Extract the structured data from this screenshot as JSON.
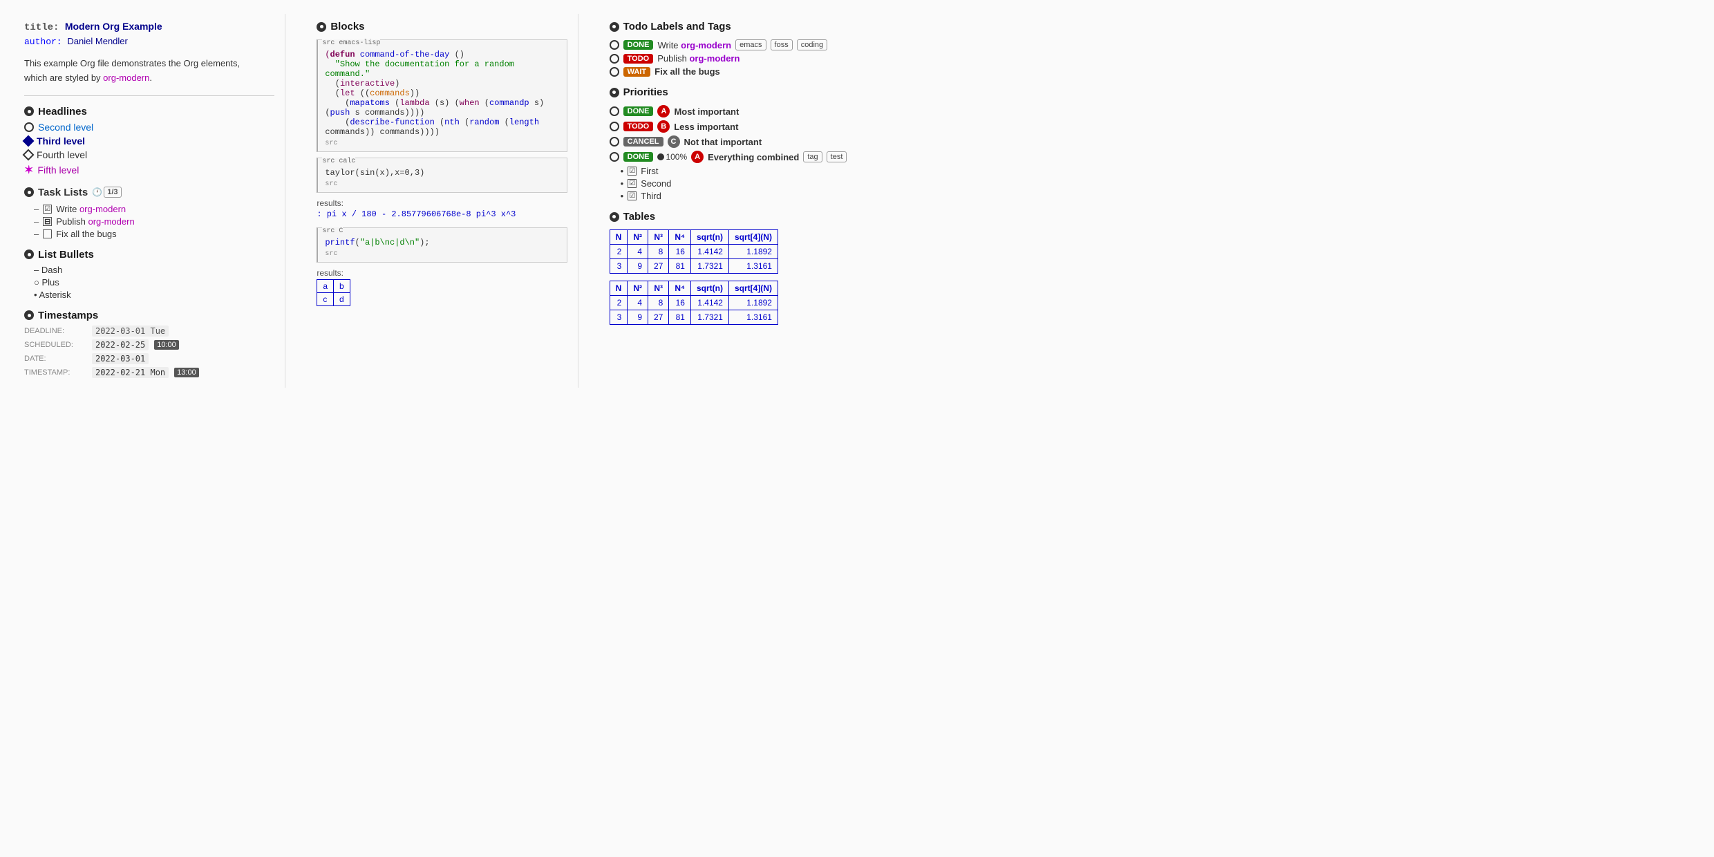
{
  "col1": {
    "meta": {
      "title_label": "title:",
      "title_value": "Modern Org Example",
      "author_label": "author:",
      "author_value": "Daniel Mendler"
    },
    "intro": "This example Org file demonstrates the Org elements, which are styled by org-modern.",
    "headlines": {
      "heading": "Headlines",
      "h2": "Second level",
      "h3": "Third level",
      "h4": "Fourth level",
      "h5": "Fifth level"
    },
    "tasks": {
      "heading": "Task Lists",
      "counter": "1/3",
      "items": [
        {
          "type": "checked",
          "text": "Write ",
          "link": "org-modern"
        },
        {
          "type": "half",
          "text": "Publish ",
          "link": "org-modern"
        },
        {
          "type": "empty",
          "text": "Fix all the bugs"
        }
      ]
    },
    "bullets": {
      "heading": "List Bullets",
      "items": [
        {
          "marker": "–",
          "text": "Dash"
        },
        {
          "marker": "○",
          "text": "Plus"
        },
        {
          "marker": "•",
          "text": "Asterisk"
        }
      ]
    },
    "timestamps": {
      "heading": "Timestamps",
      "rows": [
        {
          "label": "DEADLINE:",
          "date": "2022-03-01 Tue",
          "time": null
        },
        {
          "label": "SCHEDULED:",
          "date": "2022-02-25",
          "time": "10:00"
        },
        {
          "label": "DATE:",
          "date": "2022-03-01",
          "time": null
        },
        {
          "label": "TIMESTAMP:",
          "date": "2022-02-21 Mon",
          "time": "13:00"
        }
      ]
    }
  },
  "col2": {
    "heading": "Blocks",
    "blocks": [
      {
        "lang": "emacs-lisp",
        "lines": [
          "(defun command-of-the-day ()",
          "  \"Show the documentation for a random command.\"",
          "  (interactive)",
          "  (let ((commands))",
          "    (mapatoms (lambda (s) (when (commandp s) (push s commands))))",
          "    (describe-function (nth (random (length commands)) commands))))"
        ]
      },
      {
        "lang": "calc",
        "lines": [
          "taylor(sin(x),x=0,3)"
        ]
      }
    ],
    "results1_label": "results:",
    "results1_value": ": pi x / 180 - 2.85779606768e-8 pi^3 x^3",
    "block_c": {
      "lang": "C",
      "lines": [
        "printf(\"a|b\\nc|d\\n\");"
      ]
    },
    "results2_label": "results:",
    "results2_table": [
      [
        "a",
        "b"
      ],
      [
        "c",
        "d"
      ]
    ]
  },
  "col3": {
    "todo_section": {
      "heading": "Todo Labels and Tags",
      "items": [
        {
          "badge": "DONE",
          "badge_type": "done",
          "text": "Write ",
          "link": "org-modern",
          "tags": [
            "emacs",
            "foss",
            "coding"
          ]
        },
        {
          "badge": "TODO",
          "badge_type": "todo",
          "text": "Publish ",
          "link": "org-modern",
          "tags": []
        },
        {
          "badge": "WAIT",
          "badge_type": "wait",
          "text": "Fix all the bugs",
          "link": null,
          "tags": []
        }
      ]
    },
    "priorities_section": {
      "heading": "Priorities",
      "items": [
        {
          "badge": "DONE",
          "badge_type": "done",
          "priority": "A",
          "priority_type": "a",
          "text": "Most important"
        },
        {
          "badge": "TODO",
          "badge_type": "todo",
          "priority": "B",
          "priority_type": "b",
          "text": "Less important"
        },
        {
          "badge": "CANCEL",
          "badge_type": "cancel",
          "priority": "C",
          "priority_type": "c",
          "text": "Not that important"
        },
        {
          "badge": "DONE",
          "badge_type": "done",
          "percent": "100%",
          "priority": "A",
          "priority_type": "a",
          "text": "Everything combined",
          "tags": [
            "tag",
            "test"
          ],
          "checklist": [
            "First",
            "Second",
            "Third"
          ]
        }
      ]
    },
    "tables_section": {
      "heading": "Tables",
      "table1": {
        "headers": [
          "N",
          "N²",
          "N³",
          "N⁴",
          "sqrt(n)",
          "sqrt[4](N)"
        ],
        "rows": [
          [
            "2",
            "4",
            "8",
            "16",
            "1.4142",
            "1.1892"
          ],
          [
            "3",
            "9",
            "27",
            "81",
            "1.7321",
            "1.3161"
          ]
        ]
      },
      "table2": {
        "headers": [
          "N",
          "N²",
          "N³",
          "N⁴",
          "sqrt(n)",
          "sqrt[4](N)"
        ],
        "rows": [
          [
            "2",
            "4",
            "8",
            "16",
            "1.4142",
            "1.1892"
          ],
          [
            "3",
            "9",
            "27",
            "81",
            "1.7321",
            "1.3161"
          ]
        ]
      }
    }
  }
}
